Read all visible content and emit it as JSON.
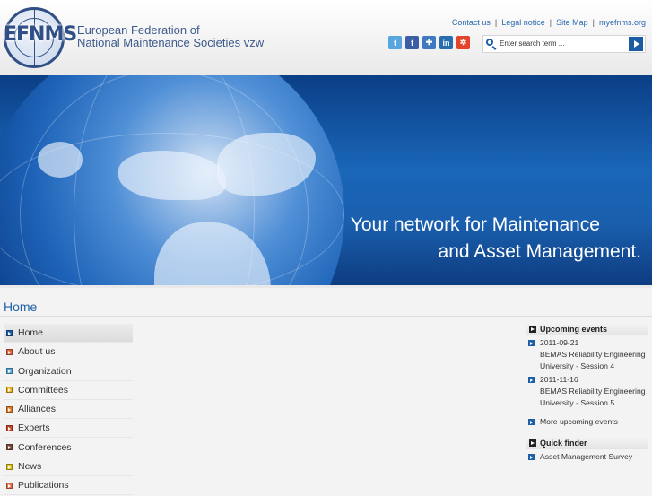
{
  "header": {
    "logo_text": "EFNMS",
    "org_name_line1": "European Federation of",
    "org_name_line2": "National Maintenance Societies vzw",
    "top_links": [
      "Contact us",
      "Legal notice",
      "Site Map",
      "myefnms.org"
    ],
    "social_icons": [
      {
        "name": "twitter-icon",
        "glyph": "t",
        "color": "#58a6dd"
      },
      {
        "name": "facebook-icon",
        "glyph": "f",
        "color": "#3b5fa5"
      },
      {
        "name": "delicious-icon",
        "glyph": "✚",
        "color": "#3e79c2"
      },
      {
        "name": "linkedin-icon",
        "glyph": "in",
        "color": "#2a6cb0"
      },
      {
        "name": "stumbleupon-icon",
        "glyph": "✲",
        "color": "#e2432a"
      }
    ],
    "search_placeholder": "Enter search term ..."
  },
  "banner": {
    "tagline_line1": "Your network for Maintenance",
    "tagline_line2": "and Asset Management."
  },
  "page_title": "Home",
  "nav": {
    "items": [
      {
        "label": "Home",
        "color": "#1f5fa8"
      },
      {
        "label": "About us",
        "color": "#e0633f"
      },
      {
        "label": "Organization",
        "color": "#57a9d9"
      },
      {
        "label": "Committees",
        "color": "#e9b21b"
      },
      {
        "label": "Alliances",
        "color": "#e07b2a"
      },
      {
        "label": "Experts",
        "color": "#c9462a"
      },
      {
        "label": "Conferences",
        "color": "#7a4a3a"
      },
      {
        "label": "News",
        "color": "#e2c21a"
      },
      {
        "label": "Publications",
        "color": "#e0704a"
      }
    ]
  },
  "upcoming": {
    "title": "Upcoming events",
    "events": [
      {
        "date": "2011-09-21",
        "text": "BEMAS Reliability Engineering University - Session 4"
      },
      {
        "date": "2011-11-16",
        "text": "BEMAS Reliability Engineering University - Session 5"
      }
    ],
    "more": "More upcoming events"
  },
  "quickfinder": {
    "title": "Quick finder",
    "items": [
      "Asset Management Survey"
    ]
  }
}
